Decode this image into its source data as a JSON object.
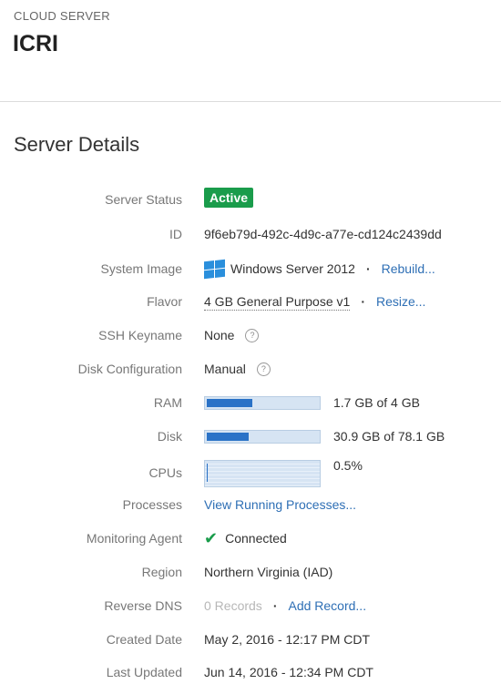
{
  "header": {
    "eyebrow": "CLOUD SERVER",
    "server_name": "ICRI"
  },
  "section_title": "Server Details",
  "details": {
    "status": {
      "label": "Server Status",
      "value": "Active"
    },
    "id": {
      "label": "ID",
      "value": "9f6eb79d-492c-4d9c-a77e-cd124c2439dd"
    },
    "image": {
      "label": "System Image",
      "value": "Windows Server 2012",
      "action": "Rebuild..."
    },
    "flavor": {
      "label": "Flavor",
      "value": "4 GB General Purpose v1",
      "action": "Resize..."
    },
    "ssh": {
      "label": "SSH Keyname",
      "value": "None",
      "help": "?"
    },
    "disk_config": {
      "label": "Disk Configuration",
      "value": "Manual",
      "help": "?"
    },
    "ram": {
      "label": "RAM",
      "value": "1.7 GB of 4 GB",
      "fraction": 0.425
    },
    "disk": {
      "label": "Disk",
      "value": "30.9 GB of 78.1 GB",
      "fraction": 0.396
    },
    "cpus": {
      "label": "CPUs",
      "value": "0.5%",
      "fraction": 0.005
    },
    "processes": {
      "label": "Processes",
      "action": "View Running Processes..."
    },
    "monitoring": {
      "label": "Monitoring Agent",
      "value": "Connected"
    },
    "region": {
      "label": "Region",
      "value": "Northern Virginia (IAD)"
    },
    "reverse_dns": {
      "label": "Reverse DNS",
      "value": "0 Records",
      "action": "Add Record..."
    },
    "created": {
      "label": "Created Date",
      "value": "May 2, 2016 - 12:17 PM CDT"
    },
    "updated": {
      "label": "Last Updated",
      "value": "Jun 14, 2016 - 12:34 PM CDT"
    }
  },
  "separator": "·",
  "colors": {
    "accent_link": "#2e6fb5",
    "status_active": "#1a9c4b",
    "bar_fill": "#2a72c7"
  },
  "icons": {
    "os": "windows-logo-icon",
    "monitoring": "check-icon",
    "help": "question-circle-icon"
  }
}
